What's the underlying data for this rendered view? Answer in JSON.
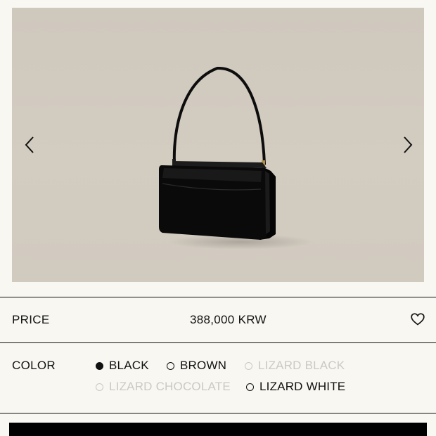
{
  "gallery": {
    "image_alt": "black leather shoulder bag product photo",
    "prev_icon": "chevron-left-icon",
    "next_icon": "chevron-right-icon"
  },
  "price": {
    "label": "PRICE",
    "value": "388,000 KRW",
    "wishlist_icon": "heart-icon"
  },
  "color": {
    "label": "COLOR",
    "options": [
      {
        "label": "BLACK",
        "state": "selected"
      },
      {
        "label": "BROWN",
        "state": "available"
      },
      {
        "label": "LIZARD BLACK",
        "state": "disabled"
      },
      {
        "label": "LIZARD CHOCOLATE",
        "state": "disabled"
      },
      {
        "label": "LIZARD WHITE",
        "state": "available"
      }
    ]
  },
  "colors": {
    "background": "#f8f7f2",
    "text": "#111111",
    "disabled": "#cbc9c3",
    "photo_backdrop": "#d1cabf"
  }
}
